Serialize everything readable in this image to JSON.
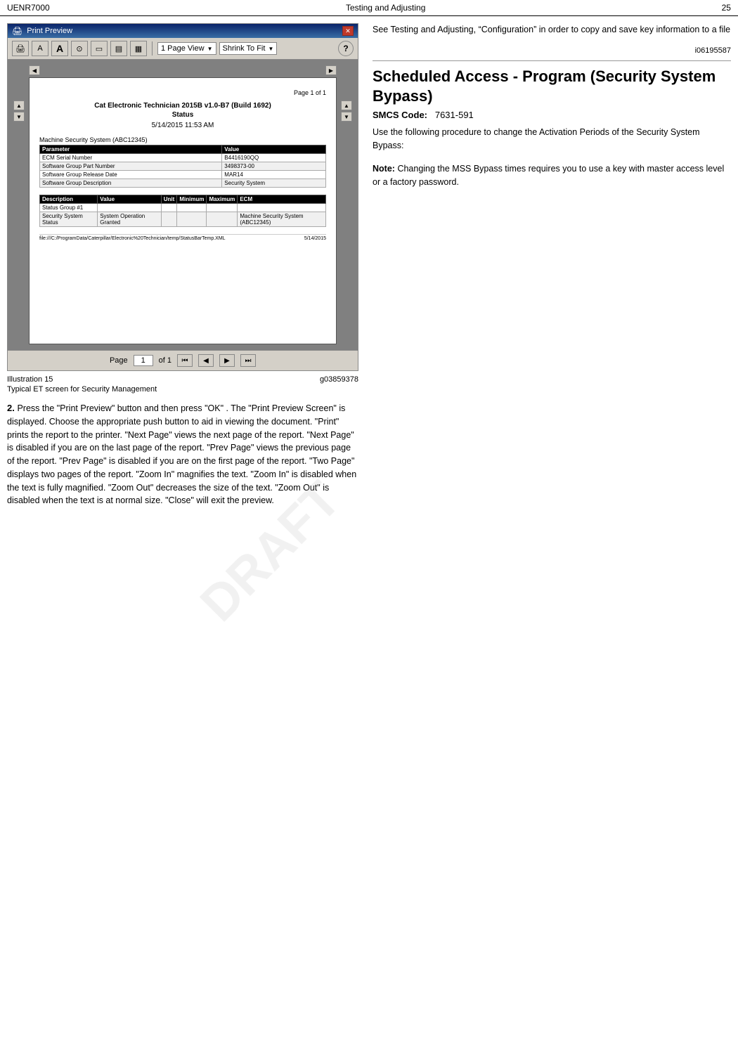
{
  "header": {
    "left": "UENR7000",
    "right": "25",
    "section": "Testing and Adjusting"
  },
  "print_preview": {
    "title": "Print Preview",
    "close_label": "✕",
    "toolbar": {
      "print_label": "🖨",
      "font_a_label": "A",
      "font_a_large_label": "A",
      "camera_label": "⊙",
      "rect_label": "▭",
      "page_label": "▤",
      "grid_label": "▦",
      "page_view_label": "1 Page View",
      "shrink_to_fit_label": "Shrink To Fit",
      "help_label": "?"
    },
    "doc": {
      "page_num": "Page 1 of 1",
      "title": "Cat Electronic Technician 2015B v1.0-B7 (Build 1692)",
      "subtitle": "Status",
      "date": "5/14/2015 11:53 AM",
      "table1_title": "Machine Security System (ABC12345)",
      "table1_headers": [
        "Parameter",
        "Value"
      ],
      "table1_rows": [
        [
          "ECM Serial Number",
          "B4416190QQ"
        ],
        [
          "Software Group Part Number",
          "3498373-00"
        ],
        [
          "Software Group Release Date",
          "MAR14"
        ],
        [
          "Software Group Description",
          "Security System"
        ]
      ],
      "table2_headers": [
        "Description",
        "Value",
        "Unit",
        "Minimum",
        "Maximum",
        "ECM"
      ],
      "table2_rows": [
        [
          "Status Group #1",
          "",
          "",
          "",
          "",
          ""
        ],
        [
          "Security System Status",
          "System Operation Granted",
          "",
          "",
          "",
          "Machine Security System (ABC12345)"
        ]
      ],
      "footer_left": "file:///C:/ProgramData/Caterpillar/Electronic%20Technician/temp/StatusBarTemp.XML",
      "footer_right": "5/14/2015"
    },
    "page_nav": {
      "page_label": "Page",
      "page_num": "1",
      "of_label": "of 1"
    }
  },
  "illustration": {
    "number": "Illustration 15",
    "id": "g03859378",
    "caption": "Typical ET screen for Security Management"
  },
  "step2": {
    "number": "2.",
    "text": "Press the  \"Print Preview\"  button and then press \"OK\" . The  \"Print Preview Screen\"  is displayed. Choose the appropriate push button to aid in viewing the document.  \"Print\"  prints the report to the printer.  \"Next Page\"  views the next page of the report.  \"Next Page\"  is disabled if you are on the last page of the report.  \"Prev Page\"  views the previous page of the report.  \"Prev Page\"  is disabled if you are on the first page of the report. \"Two Page\"  displays two pages of the report. \"Zoom In\"  magnifies the text.  \"Zoom In\"  is disabled when the text is fully magnified.  \"Zoom Out\"  decreases the size of the text.  \"Zoom Out\"  is disabled when the text is at normal size.  \"Close\" will exit the preview."
  },
  "right_col": {
    "see_text": "See Testing and Adjusting, “Configuration” in order to copy and save key information to a file",
    "ref_id": "i06195587",
    "section_title": "Scheduled Access - Program (Security System Bypass)",
    "smcs_label": "SMCS Code:",
    "smcs_value": "7631-591",
    "use_text": "Use the following procedure to change the Activation Periods of the Security System Bypass:",
    "note_label": "Note:",
    "note_text": "Changing the MSS Bypass times requires you to use a key with master access level or a factory password."
  },
  "watermark": "DRAFT"
}
